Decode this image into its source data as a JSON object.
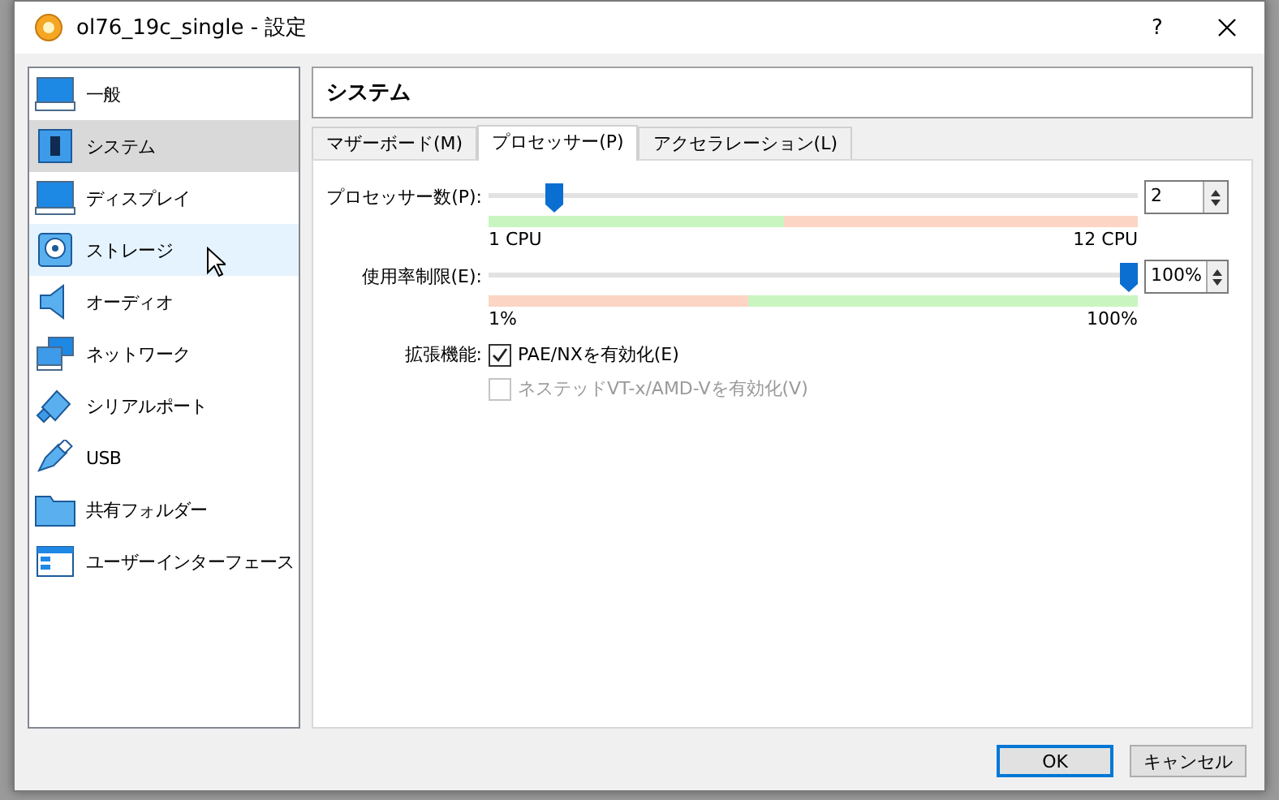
{
  "window": {
    "title": "ol76_19c_single - 設定",
    "help": "?"
  },
  "sidebar": {
    "items": [
      {
        "label": "一般",
        "selected": false,
        "hovered": false
      },
      {
        "label": "システム",
        "selected": true,
        "hovered": false
      },
      {
        "label": "ディスプレイ",
        "selected": false,
        "hovered": false
      },
      {
        "label": "ストレージ",
        "selected": false,
        "hovered": true
      },
      {
        "label": "オーディオ",
        "selected": false,
        "hovered": false
      },
      {
        "label": "ネットワーク",
        "selected": false,
        "hovered": false
      },
      {
        "label": "シリアルポート",
        "selected": false,
        "hovered": false
      },
      {
        "label": "USB",
        "selected": false,
        "hovered": false
      },
      {
        "label": "共有フォルダー",
        "selected": false,
        "hovered": false
      },
      {
        "label": "ユーザーインターフェース",
        "selected": false,
        "hovered": false
      }
    ]
  },
  "page_title": "システム",
  "tabs": [
    {
      "label": "マザーボード(M)",
      "selected": false
    },
    {
      "label": "プロセッサー(P)",
      "selected": true
    },
    {
      "label": "アクセラレーション(L)",
      "selected": false
    }
  ],
  "sliders": [
    {
      "label": "プロセッサー数(P):",
      "level": 0.09,
      "min_label": "1 CPU",
      "max_label": "12 CPU",
      "value": "2"
    },
    {
      "label": "使用率制限(E):",
      "level": 1,
      "min_label": "1%",
      "max_label": "100%",
      "value": "100%"
    }
  ],
  "extended": {
    "label": "拡張機能:",
    "options": [
      {
        "label": "PAE/NXを有効化(E)",
        "checked": true,
        "disabled": false
      },
      {
        "label": "ネステッドVT-x/AMD-Vを有効化(V)",
        "checked": false,
        "disabled": true
      }
    ]
  },
  "buttons": [
    {
      "label": "OK",
      "default": true
    },
    {
      "label": "キャンセル",
      "default": false
    }
  ]
}
